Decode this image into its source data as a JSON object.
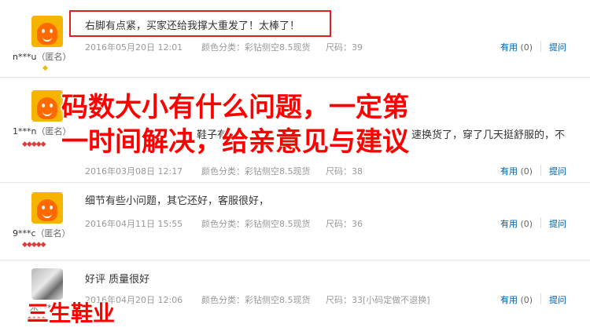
{
  "reviews": [
    {
      "username": "n***u",
      "anon": "（匿名）",
      "badge": "◆",
      "content": "右脚有点紧，买家还给我撑大重发了！太棒了！",
      "date": "2016年05月20日 12:01",
      "color": "颜色分类：彩钻侧空8.5现货",
      "size": "尺码：39",
      "useful_label": "有用",
      "useful_count": "(0)",
      "reply_label": "提问"
    },
    {
      "username": "1***n",
      "anon": "（匿名）",
      "badges": "◆◆◆◆◆",
      "content_partial_left": "鞋子有",
      "content_partial_right": "速换货了，穿了几天挺舒服的，不",
      "date": "2016年03月08日 12:17",
      "color": "颜色分类：彩钻侧空8.5现货",
      "size": "尺码：38",
      "useful_label": "有用",
      "useful_count": "(0)",
      "reply_label": "提问"
    },
    {
      "username": "9***c",
      "anon": "（匿名）",
      "badges": "◆◆◆◆◆",
      "content": "细节有些小问题，其它还好，客服很好，",
      "date": "2016年04月11日 15:55",
      "color": "颜色分类：彩钻侧空8.5现货",
      "size": "尺码：36",
      "useful_label": "有用",
      "useful_count": "(0)",
      "reply_label": "提问"
    },
    {
      "username": "木***5",
      "badges": "◆◆◆◆",
      "content": "好评 质量很好",
      "date": "2016年04月20日 12:06",
      "color": "颜色分类：彩钻侧空8.5现货",
      "size": "尺码：33[小码定做不退换]",
      "useful_label": "有用",
      "useful_count": "(0)",
      "reply_label": "提问"
    }
  ],
  "overlay": {
    "line1": "码数大小有什么问题，一定第",
    "line2": "一时间解决，给亲意见与建议",
    "watermark": "三生鞋业"
  },
  "colors": {
    "link": "#005ea7",
    "meta": "#999999",
    "highlight": "#e02020",
    "overlay_text": "#ff0000"
  }
}
